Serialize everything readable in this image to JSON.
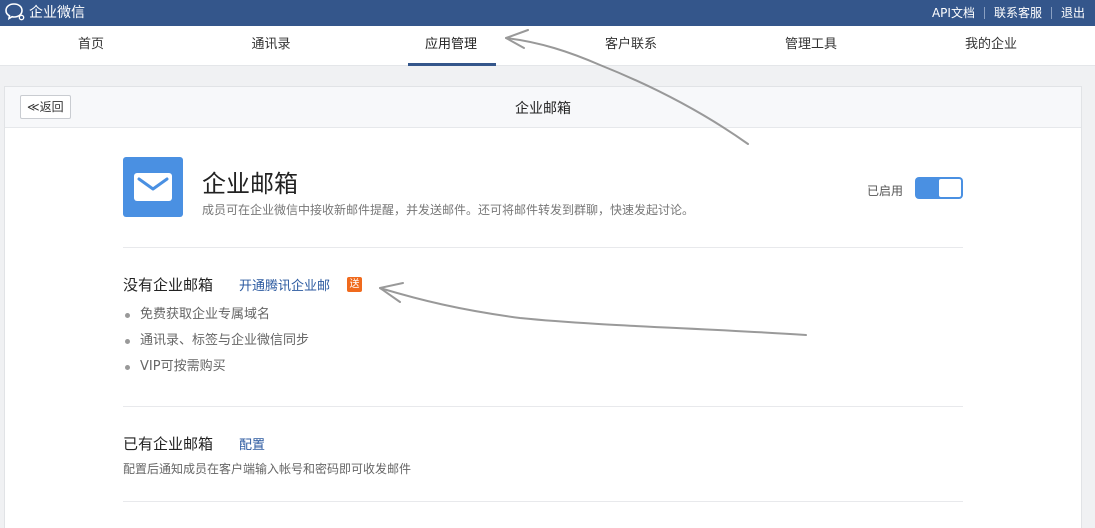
{
  "topbar": {
    "brand": "企业微信",
    "links": [
      "API文档",
      "联系客服",
      "退出"
    ]
  },
  "nav": {
    "items": [
      "首页",
      "通讯录",
      "应用管理",
      "客户联系",
      "管理工具",
      "我的企业"
    ],
    "active": "应用管理"
  },
  "card": {
    "back_label": "≪返回",
    "title": "企业邮箱"
  },
  "app": {
    "name": "企业邮箱",
    "description": "成员可在企业微信中接收新邮件提醒，并发送邮件。还可将邮件转发到群聊，快速发起讨论。",
    "status_label": "已启用",
    "enabled": true,
    "icon": "mail-icon",
    "icon_color": "#4a90e2"
  },
  "section_no_mailbox": {
    "title": "没有企业邮箱",
    "link": "开通腾讯企业邮",
    "badge": "送",
    "features": [
      "免费获取企业专属域名",
      "通讯录、标签与企业微信同步",
      "VIP可按需购买"
    ]
  },
  "section_has_mailbox": {
    "title": "已有企业邮箱",
    "link": "配置",
    "description": "配置后通知成员在客户端输入帐号和密码即可收发邮件"
  },
  "colors": {
    "topbar": "#34568b",
    "accent": "#4a90e2",
    "link": "#2c5aa0",
    "badge": "#f06a1d"
  }
}
